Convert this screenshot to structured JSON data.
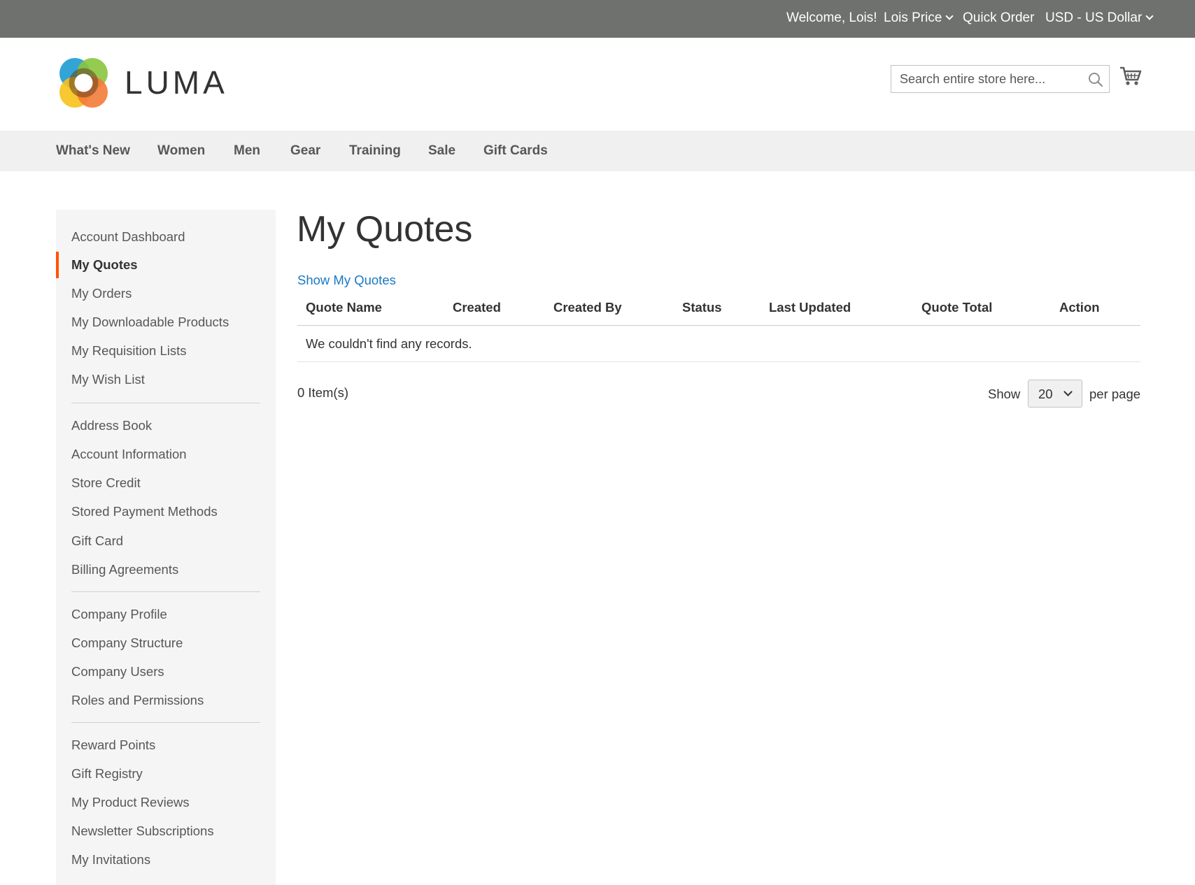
{
  "topbar": {
    "welcome": "Welcome, Lois!",
    "account_name": "Lois Price",
    "quick_order": "Quick Order",
    "currency": "USD - US Dollar"
  },
  "header": {
    "logo_text": "LUMA",
    "search_placeholder": "Search entire store here..."
  },
  "nav": {
    "items": [
      "What's New",
      "Women",
      "Men",
      "Gear",
      "Training",
      "Sale",
      "Gift Cards"
    ]
  },
  "sidebar": {
    "items": [
      "Account Dashboard",
      "My Quotes",
      "My Orders",
      "My Downloadable Products",
      "My Requisition Lists",
      "My Wish List",
      "Address Book",
      "Account Information",
      "Store Credit",
      "Stored Payment Methods",
      "Gift Card",
      "Billing Agreements",
      "Company Profile",
      "Company Structure",
      "Company Users",
      "Roles and Permissions",
      "Reward Points",
      "Gift Registry",
      "My Product Reviews",
      "Newsletter Subscriptions",
      "My Invitations"
    ],
    "active": "My Quotes"
  },
  "main": {
    "title": "My Quotes",
    "show_link": "Show My Quotes",
    "columns": [
      "Quote Name",
      "Created",
      "Created By",
      "Status",
      "Last Updated",
      "Quote Total",
      "Action"
    ],
    "empty_message": "We couldn't find any records.",
    "item_count": "0 Item(s)",
    "show_label": "Show",
    "per_page_value": "20",
    "per_page_label": "per page"
  },
  "colors": {
    "topbar_bg": "#6e716e",
    "nav_bg": "#f0f0f0",
    "sidebar_bg": "#f5f5f5",
    "active_accent": "#ff5501",
    "link": "#1979c3"
  }
}
